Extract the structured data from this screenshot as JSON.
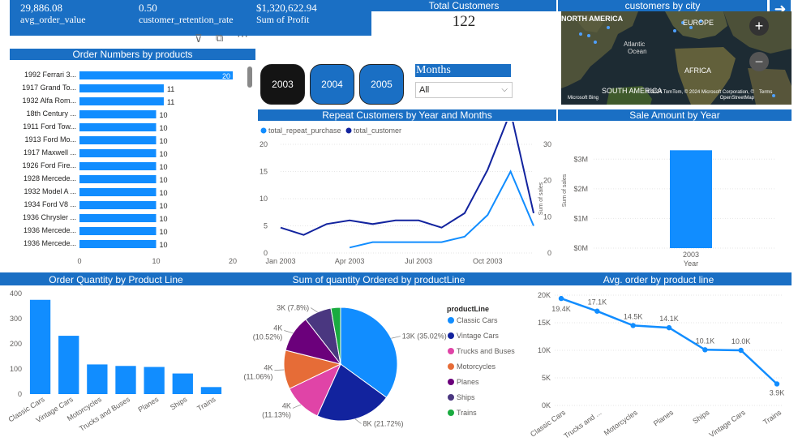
{
  "kpis": [
    {
      "value": "29,886.08",
      "label": "avg_order_value"
    },
    {
      "value": "0.50",
      "label": "customer_retention_rate"
    },
    {
      "value": "$1,320,622.94",
      "label": "Sum of Profit"
    }
  ],
  "total_customers": {
    "title": "Total Customers",
    "value": "122"
  },
  "map": {
    "title": "customers by city",
    "labels": {
      "north_america": "NORTH AMERICA",
      "europe": "EUROPE",
      "atlantic": "Atlantic",
      "ocean": "Ocean",
      "africa": "AFRICA",
      "south_america": "SOUTH AMERICA"
    },
    "attribution": "© 2024 TomTom, © 2024 Microsoft Corporation, © OpenStreetMap",
    "terms": "Terms",
    "bing": "Microsoft Bing"
  },
  "slicer": {
    "years": [
      "2003",
      "2004",
      "2005"
    ],
    "selected_year": "2003",
    "months_label": "Months",
    "months_value": "All"
  },
  "colors": {
    "primary": "#118dff",
    "dark": "#12239e",
    "header": "#1a6fc4"
  },
  "chart_data": [
    {
      "id": "order-numbers",
      "type": "bar",
      "orientation": "horizontal",
      "title": "Order Numbers by products",
      "categories": [
        "1992 Ferrari 3...",
        "1917 Grand To...",
        "1932 Alfa Rom...",
        "18th Century ...",
        "1911 Ford Tow...",
        "1913 Ford Mo...",
        "1917 Maxwell ...",
        "1926 Ford Fire...",
        "1928 Mercede...",
        "1932 Model A ...",
        "1934 Ford V8 ...",
        "1936 Chrysler ...",
        "1936 Mercede...",
        "1936 Mercede..."
      ],
      "values": [
        20,
        11,
        11,
        10,
        10,
        10,
        10,
        10,
        10,
        10,
        10,
        10,
        10,
        10
      ],
      "xlim": [
        0,
        20
      ],
      "xticks": [
        "0",
        "10",
        "20"
      ]
    },
    {
      "id": "repeat-customers",
      "type": "line",
      "title": "Repeat Customers by Year and Months",
      "x": [
        "Jan 2003",
        "Feb 2003",
        "Mar 2003",
        "Apr 2003",
        "May 2003",
        "Jun 2003",
        "Jul 2003",
        "Aug 2003",
        "Sep 2003",
        "Oct 2003",
        "Nov 2003",
        "Dec 2003"
      ],
      "xticks": [
        "Jan 2003",
        "Apr 2003",
        "Jul 2003",
        "Oct 2003"
      ],
      "series": [
        {
          "name": "total_repeat_purchase",
          "axis": "left",
          "values": [
            null,
            null,
            null,
            1,
            2,
            2,
            2,
            2,
            3,
            7,
            15,
            5
          ]
        },
        {
          "name": "total_customer",
          "axis": "right",
          "values": [
            7,
            5,
            8,
            9,
            8,
            9,
            9,
            7,
            11,
            23,
            39,
            11
          ]
        }
      ],
      "ylim_left": [
        0,
        20
      ],
      "yticks_left": [
        "0",
        "5",
        "10",
        "15",
        "20"
      ],
      "ylim_right": [
        0,
        30
      ],
      "yticks_right": [
        "0",
        "10",
        "20",
        "30"
      ],
      "ylabel_right": "Sum of sales"
    },
    {
      "id": "sale-amount",
      "type": "bar",
      "title": "Sale Amount by Year",
      "categories": [
        "2003"
      ],
      "values": [
        3.3
      ],
      "ylim": [
        0,
        3.5
      ],
      "yticks": [
        "$0M",
        "$1M",
        "$2M",
        "$3M"
      ],
      "ylabel": "Sum of sales",
      "xlabel": "Year"
    },
    {
      "id": "order-quantity",
      "type": "bar",
      "title": "Order Quantity by Product Line",
      "categories": [
        "Classic Cars",
        "Vintage Cars",
        "Motorcycles",
        "Trucks and Buses",
        "Planes",
        "Ships",
        "Trains"
      ],
      "values": [
        375,
        232,
        118,
        112,
        108,
        82,
        28
      ],
      "ylim": [
        0,
        400
      ],
      "yticks": [
        "0",
        "100",
        "200",
        "300",
        "400"
      ]
    },
    {
      "id": "quantity-pie",
      "type": "pie",
      "title": "Sum of quantity Ordered by productLine",
      "legend_title": "productLine",
      "categories": [
        "Classic Cars",
        "Vintage Cars",
        "Trucks and Buses",
        "Motorcycles",
        "Planes",
        "Ships",
        "Trains"
      ],
      "slices": [
        {
          "name": "Classic Cars",
          "value": 35.02,
          "label": "13K (35.02%)",
          "color": "#118dff"
        },
        {
          "name": "Vintage Cars",
          "value": 21.72,
          "label": "8K (21.72%)",
          "color": "#12239e"
        },
        {
          "name": "Trucks and Buses",
          "value": 11.13,
          "label": "4K (11.13%)",
          "color": "#e044a7"
        },
        {
          "name": "Motorcycles",
          "value": 11.06,
          "label": "4K (11.06%)",
          "color": "#e66c37"
        },
        {
          "name": "Planes",
          "value": 10.52,
          "label": "4K (10.52%)",
          "color": "#6b007b"
        },
        {
          "name": "Ships",
          "value": 7.8,
          "label": "3K (7.8%)",
          "color": "#4a3780"
        },
        {
          "name": "Trains",
          "value": 2.75,
          "label": "",
          "color": "#1aab40"
        }
      ]
    },
    {
      "id": "avg-order",
      "type": "line",
      "title": "Avg. order by product line",
      "categories": [
        "Classic Cars",
        "Trucks and ...",
        "Motorcycles",
        "Planes",
        "Ships",
        "Vintage Cars",
        "Trains"
      ],
      "values": [
        19.4,
        17.1,
        14.5,
        14.1,
        10.1,
        10.0,
        3.9
      ],
      "data_labels": [
        "19.4K",
        "17.1K",
        "14.5K",
        "14.1K",
        "10.1K",
        "10.0K",
        "3.9K"
      ],
      "ylim": [
        0,
        20
      ],
      "yticks": [
        "0K",
        "5K",
        "10K",
        "15K",
        "20K"
      ]
    }
  ]
}
